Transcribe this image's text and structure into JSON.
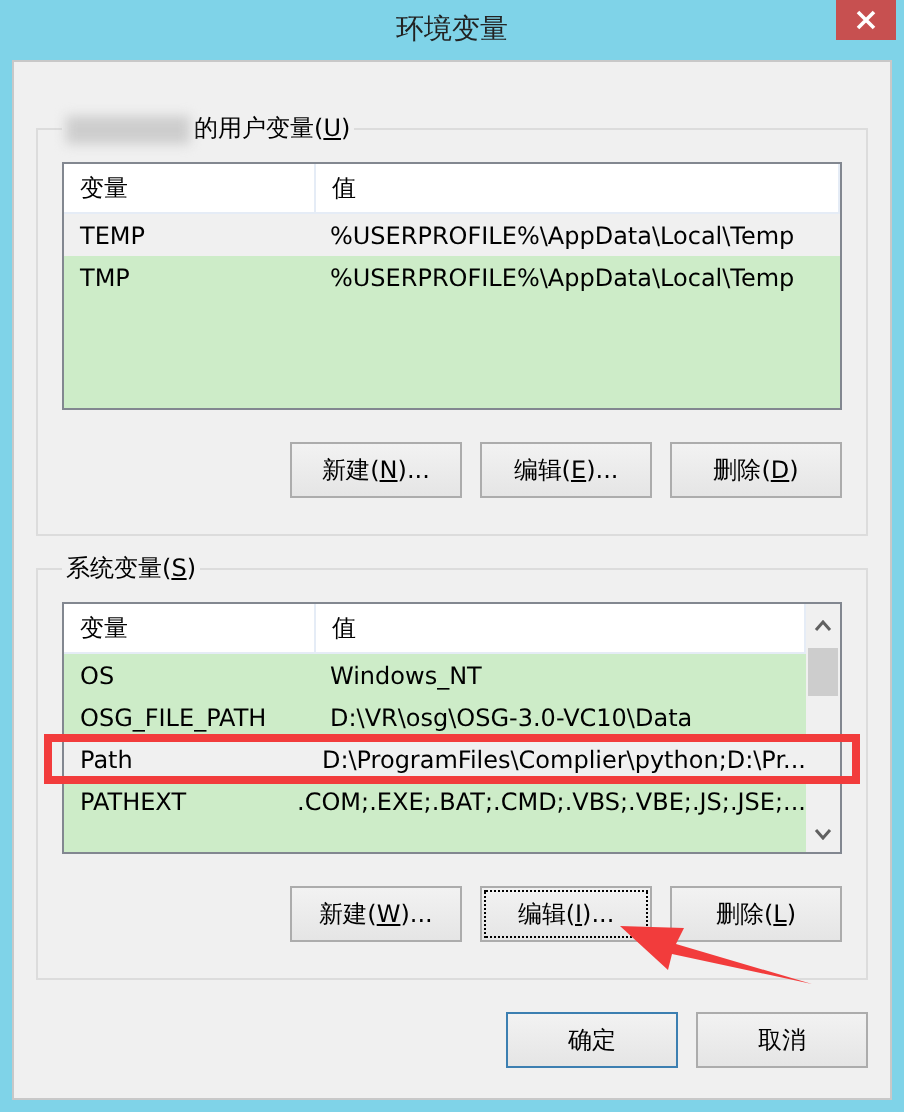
{
  "window": {
    "title": "环境变量"
  },
  "user_group": {
    "label": {
      "before": "的用户变量(",
      "mnemonic": "U",
      "after": ")"
    },
    "columns": [
      "变量",
      "值"
    ],
    "rows": [
      {
        "name": "TEMP",
        "value": "%USERPROFILE%\\AppData\\Local\\Temp",
        "selected": true
      },
      {
        "name": "TMP",
        "value": "%USERPROFILE%\\AppData\\Local\\Temp",
        "selected": false
      }
    ],
    "buttons": [
      {
        "before": "新建(",
        "mnemonic": "N",
        "after": ")...",
        "focused": false
      },
      {
        "before": "编辑(",
        "mnemonic": "E",
        "after": ")...",
        "focused": false
      },
      {
        "before": "删除(",
        "mnemonic": "D",
        "after": ")",
        "focused": false
      }
    ]
  },
  "system_group": {
    "label": {
      "before": "系统变量(",
      "mnemonic": "S",
      "after": ")"
    },
    "columns": [
      "变量",
      "值"
    ],
    "rows": [
      {
        "name": "OS",
        "value": "Windows_NT",
        "selected": false
      },
      {
        "name": "OSG_FILE_PATH",
        "value": "D:\\VR\\osg\\OSG-3.0-VC10\\Data",
        "selected": false
      },
      {
        "name": "Path",
        "value": "D:\\ProgramFiles\\Complier\\python;D:\\Pr...",
        "selected": true
      },
      {
        "name": "PATHEXT",
        "value": ".COM;.EXE;.BAT;.CMD;.VBS;.VBE;.JS;.JSE;...",
        "selected": false
      }
    ],
    "buttons": [
      {
        "before": "新建(",
        "mnemonic": "W",
        "after": ")...",
        "focused": false
      },
      {
        "before": "编辑(",
        "mnemonic": "I",
        "after": ")...",
        "focused": true
      },
      {
        "before": "删除(",
        "mnemonic": "L",
        "after": ")",
        "focused": false
      }
    ]
  },
  "footer_buttons": [
    {
      "label": "确定",
      "default": true
    },
    {
      "label": "取消",
      "default": false
    }
  ]
}
